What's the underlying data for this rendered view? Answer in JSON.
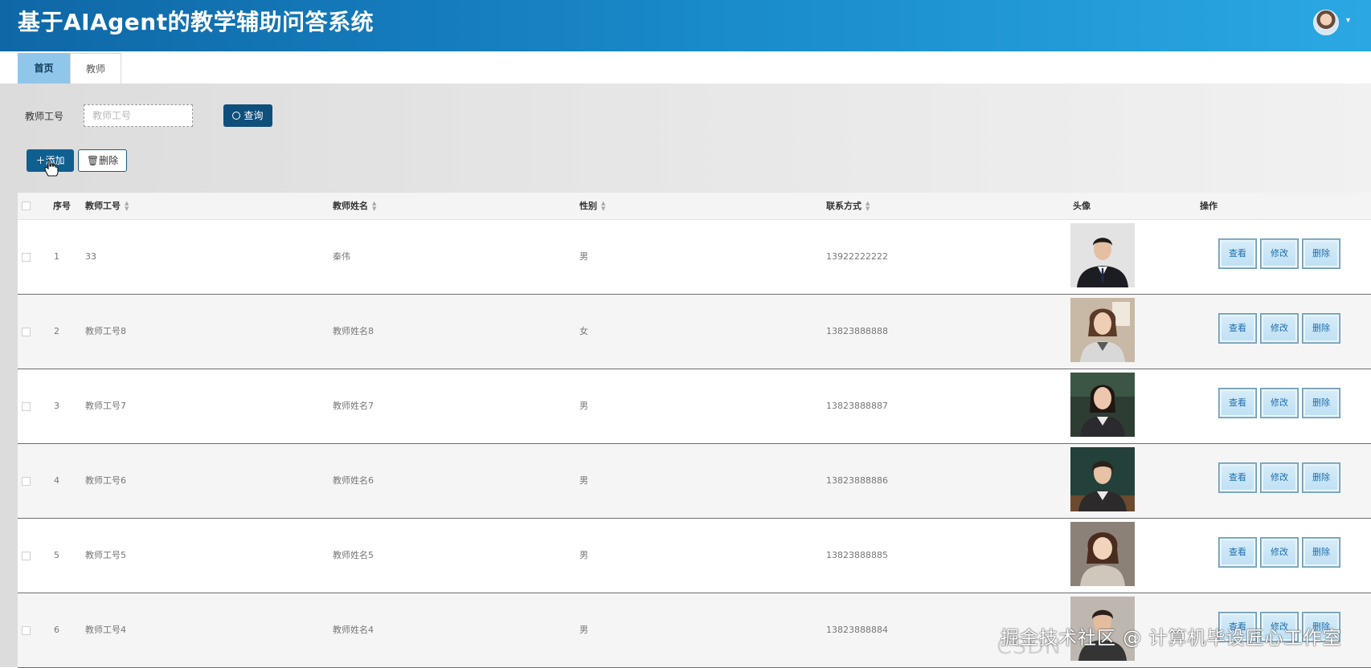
{
  "header": {
    "title": "基于AIAgent的教学辅助问答系统",
    "caret": "▾"
  },
  "tabs": [
    {
      "label": "首页"
    },
    {
      "label": "教师"
    }
  ],
  "search": {
    "label": "教师工号",
    "placeholder": "教师工号",
    "query_label": "查询"
  },
  "actions": {
    "add_label": "添加",
    "delete_label": "删除"
  },
  "table": {
    "columns": [
      {
        "label": "序号",
        "sortable": false
      },
      {
        "label": "教师工号",
        "sortable": true
      },
      {
        "label": "教师姓名",
        "sortable": true
      },
      {
        "label": "性别",
        "sortable": true
      },
      {
        "label": "联系方式",
        "sortable": true
      },
      {
        "label": "头像",
        "sortable": false
      },
      {
        "label": "操作",
        "sortable": false
      }
    ],
    "rows": [
      {
        "index": "1",
        "teacher_id": "33",
        "name": "秦伟",
        "gender": "男",
        "phone": "13922222222"
      },
      {
        "index": "2",
        "teacher_id": "教师工号8",
        "name": "教师姓名8",
        "gender": "女",
        "phone": "13823888888"
      },
      {
        "index": "3",
        "teacher_id": "教师工号7",
        "name": "教师姓名7",
        "gender": "男",
        "phone": "13823888887"
      },
      {
        "index": "4",
        "teacher_id": "教师工号6",
        "name": "教师姓名6",
        "gender": "男",
        "phone": "13823888886"
      },
      {
        "index": "5",
        "teacher_id": "教师工号5",
        "name": "教师姓名5",
        "gender": "男",
        "phone": "13823888885"
      },
      {
        "index": "6",
        "teacher_id": "教师工号4",
        "name": "教师姓名4",
        "gender": "男",
        "phone": "13823888884"
      }
    ],
    "row_actions": {
      "view": "查看",
      "edit": "修改",
      "delete": "删除"
    }
  },
  "watermark": "掘金技术社区 @ 计算机毕设匠心工作室",
  "colors": {
    "header_start": "#0f67a6",
    "header_end": "#2ba8e3",
    "primary_button": "#0f5f8f",
    "active_tab": "#8fc6ea",
    "op_button": "#bfe0f4"
  }
}
